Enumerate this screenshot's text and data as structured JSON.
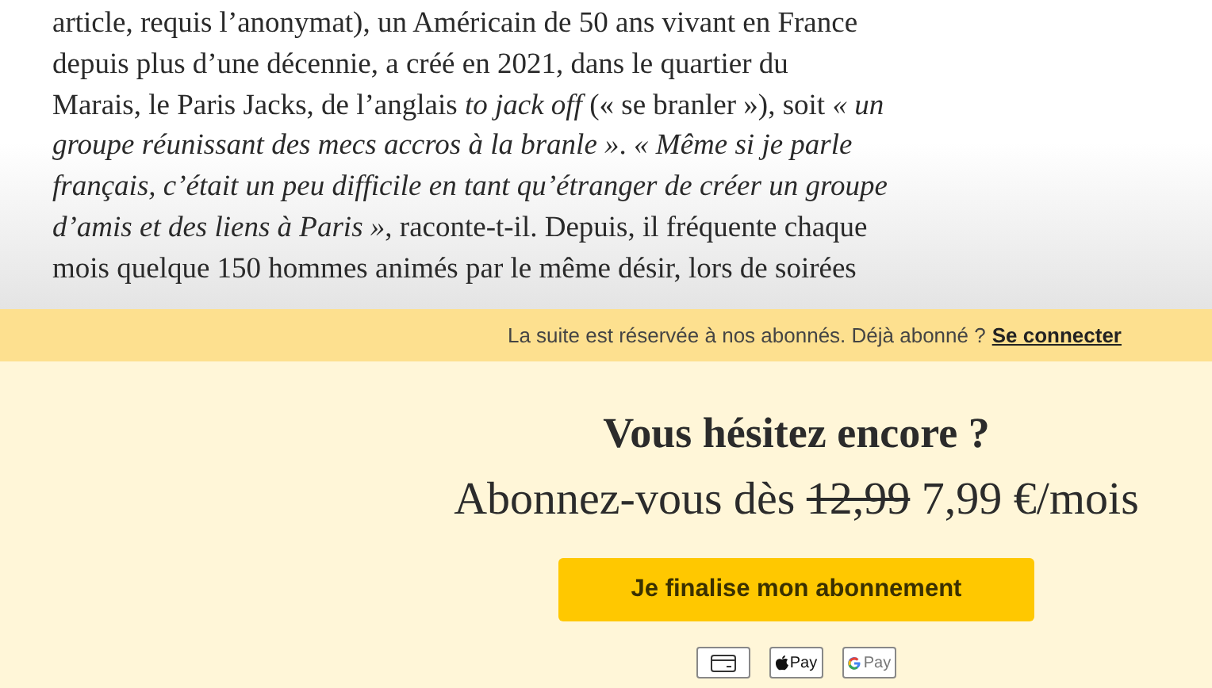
{
  "article": {
    "lines": [
      "article, requis l’anonymat), un Américain de 50 ans vivant en France",
      "depuis plus d’une décennie, a créé en 2021, dans le quartier du",
      "Marais, le Paris Jacks, de l’anglais *to jack off* (« se branler »), soit *« un*",
      "*groupe réunissant des mecs accros à la branle »*. *« Même si je parle*",
      "*français, c’était un peu difficile en tant qu’étranger de créer un groupe*",
      "*d’amis et des liens à Paris »*, raconte-t-il. Depuis, il fréquente chaque",
      "mois quelque 150 hommes animés par le même désir, lors de soirées"
    ]
  },
  "paywall": {
    "notice": "La suite est réservée à nos abonnés. Déjà abonné ?",
    "login_link": "Se connecter"
  },
  "offer": {
    "title": "Vous hésitez encore ?",
    "price_prefix": "Abonnez-vous dès",
    "old_price": "12,99",
    "new_price": "7,99 €/mois",
    "cta": "Je finalise mon abonnement"
  },
  "payment_methods": [
    {
      "kind": "card"
    },
    {
      "kind": "apple_pay",
      "label": "Pay"
    },
    {
      "kind": "google_pay",
      "label": "Pay"
    }
  ]
}
